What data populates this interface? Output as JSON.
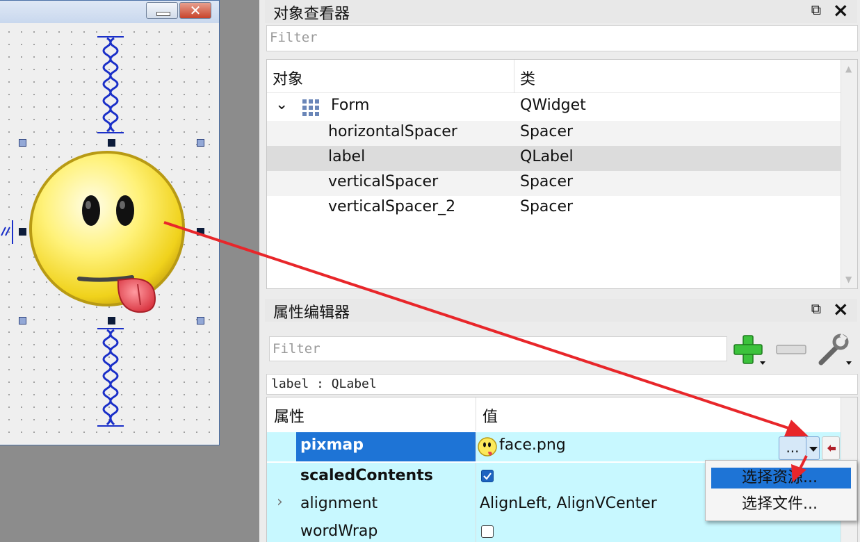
{
  "object_inspector": {
    "title": "对象查看器",
    "filter_placeholder": "Filter",
    "columns": [
      "对象",
      "类"
    ],
    "rows": [
      {
        "object": "Form",
        "class": "QWidget"
      },
      {
        "object": "horizontalSpacer",
        "class": "Spacer"
      },
      {
        "object": "label",
        "class": "QLabel"
      },
      {
        "object": "verticalSpacer",
        "class": "Spacer"
      },
      {
        "object": "verticalSpacer_2",
        "class": "Spacer"
      }
    ]
  },
  "property_editor": {
    "title": "属性编辑器",
    "filter_placeholder": "Filter",
    "current_object": "label : QLabel",
    "columns": [
      "属性",
      "值"
    ],
    "rows": [
      {
        "name": "pixmap",
        "value": "face.png"
      },
      {
        "name": "scaledContents",
        "value": ""
      },
      {
        "name": "alignment",
        "value": "AlignLeft, AlignVCenter"
      },
      {
        "name": "wordWrap",
        "value": ""
      }
    ],
    "browse_label": "...",
    "popup_menu": [
      "选择资源...",
      "选择文件..."
    ]
  },
  "colors": {
    "selection_blue": "#1e74d6",
    "highlight_row": "#c8f8ff",
    "arrow_red": "#e8262a"
  }
}
